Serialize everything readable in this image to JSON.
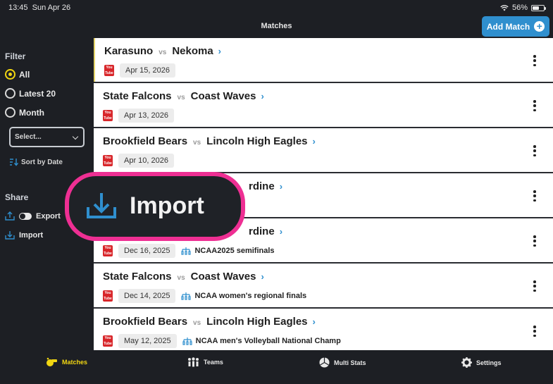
{
  "status_bar": {
    "time": "13:45",
    "date": "Sun Apr 26",
    "battery": "56%"
  },
  "nav": {
    "title": "Matches",
    "add_button": "Add Match"
  },
  "sidebar": {
    "filter_heading": "Filter",
    "filters": [
      {
        "label": "All",
        "selected": true
      },
      {
        "label": "Latest 20",
        "selected": false
      },
      {
        "label": "Month",
        "selected": false
      }
    ],
    "select_value": "Select...",
    "sort_label": "Sort by Date",
    "share_heading": "Share",
    "export_label": "Export",
    "import_label": "Import"
  },
  "matches": [
    {
      "team_a": "Karasuno",
      "vs": "vs",
      "team_b": "Nekoma",
      "date": "Apr 15, 2026",
      "tournament": ""
    },
    {
      "team_a": "State Falcons",
      "vs": "vs",
      "team_b": "Coast Waves",
      "date": "Apr 13, 2026",
      "tournament": ""
    },
    {
      "team_a": "Brookfield Bears",
      "vs": "vs",
      "team_b": "Lincoln High Eagles",
      "date": "Apr 10, 2026",
      "tournament": ""
    },
    {
      "team_a": "",
      "vs": "",
      "team_b": "rdine",
      "date": "",
      "tournament": ""
    },
    {
      "team_a": "",
      "vs": "",
      "team_b": "rdine",
      "date": "Dec 16, 2025",
      "tournament": "NCAA2025 semifinals"
    },
    {
      "team_a": "State Falcons",
      "vs": "vs",
      "team_b": "Coast Waves",
      "date": "Dec 14, 2025",
      "tournament": "NCAA women's regional finals"
    },
    {
      "team_a": "Brookfield Bears",
      "vs": "vs",
      "team_b": "Lincoln High Eagles",
      "date": "May 12, 2025",
      "tournament": "NCAA men's Volleyball National Champ"
    }
  ],
  "callout": {
    "label": "Import"
  },
  "tabs": [
    {
      "label": "Matches",
      "icon": "whistle-icon",
      "active": true
    },
    {
      "label": "Teams",
      "icon": "people-icon",
      "active": false
    },
    {
      "label": "Multi Stats",
      "icon": "pie-chart-icon",
      "active": false
    },
    {
      "label": "Settings",
      "icon": "gear-icon",
      "active": false
    }
  ],
  "colors": {
    "accent_blue": "#2f8fce",
    "active_yellow": "#f1d612",
    "callout_pink": "#ee2f93"
  }
}
